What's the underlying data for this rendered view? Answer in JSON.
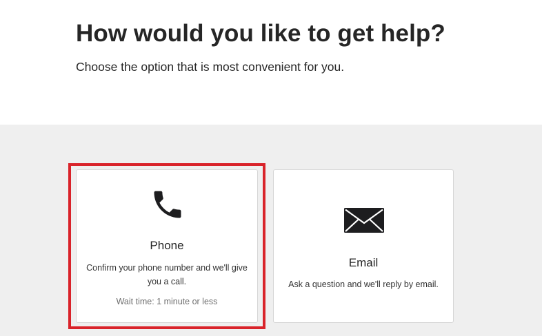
{
  "header": {
    "title": "How would you like to get help?",
    "subtitle": "Choose the option that is most convenient for you."
  },
  "options": [
    {
      "icon": "phone-icon",
      "title": "Phone",
      "description": "Confirm your phone number and we'll give you a call.",
      "wait_time": "Wait time: 1 minute or less",
      "highlighted": true
    },
    {
      "icon": "envelope-icon",
      "title": "Email",
      "description": "Ask a question and we'll reply by email.",
      "highlighted": false
    }
  ],
  "colors": {
    "highlight": "#d9232a",
    "options_background": "#efefef",
    "card_border": "#d6d6d6",
    "icon": "#1d1d1f"
  }
}
